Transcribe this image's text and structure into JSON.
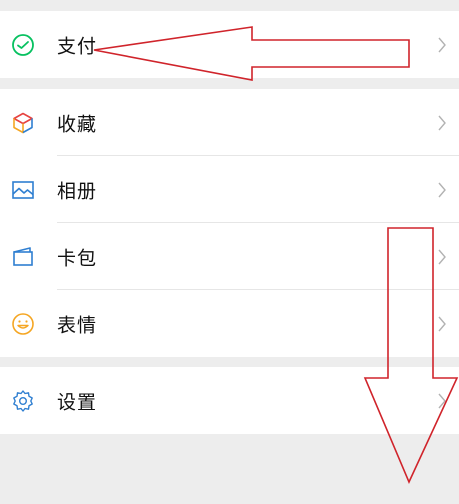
{
  "groups": [
    {
      "items": [
        {
          "label": "支付",
          "icon": "pay-icon",
          "color": "#07c160"
        }
      ]
    },
    {
      "items": [
        {
          "label": "收藏",
          "icon": "favorites-icon",
          "color": "#f5a623"
        },
        {
          "label": "相册",
          "icon": "album-icon",
          "color": "#2f7fd1"
        },
        {
          "label": "卡包",
          "icon": "card-wallet-icon",
          "color": "#2f7fd1"
        },
        {
          "label": "表情",
          "icon": "emoji-icon",
          "color": "#f5a623"
        }
      ]
    },
    {
      "items": [
        {
          "label": "设置",
          "icon": "settings-icon",
          "color": "#2f7fd1"
        }
      ]
    }
  ],
  "colors": {
    "background": "#ededed",
    "surface": "#ffffff",
    "annotation": "#d0242b",
    "chevron": "#b2b2b2"
  }
}
